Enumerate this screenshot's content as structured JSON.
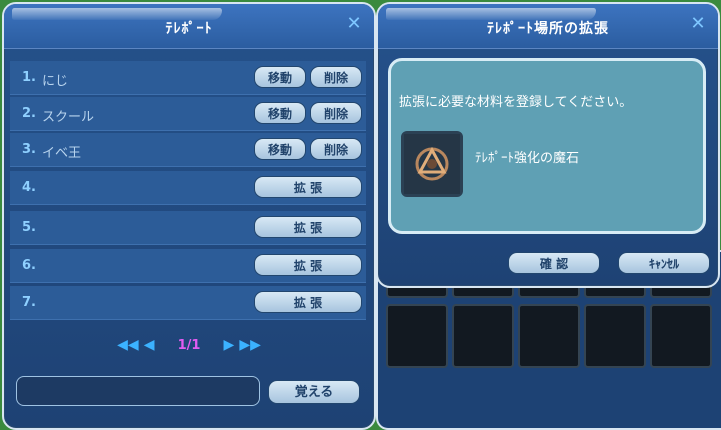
{
  "teleport_window": {
    "title": "ﾃﾚﾎﾟｰﾄ",
    "slots": [
      {
        "num": "1.",
        "name": "にじ",
        "move_label": "移動",
        "delete_label": "削除"
      },
      {
        "num": "2.",
        "name": "スクール",
        "move_label": "移動",
        "delete_label": "削除"
      },
      {
        "num": "3.",
        "name": "イベ王",
        "move_label": "移動",
        "delete_label": "削除"
      },
      {
        "num": "4.",
        "name": "",
        "expand_label": "拡 張"
      },
      {
        "num": "5.",
        "name": "",
        "expand_label": "拡 張"
      },
      {
        "num": "6.",
        "name": "",
        "expand_label": "拡 張"
      },
      {
        "num": "7.",
        "name": "",
        "expand_label": "拡 張"
      }
    ],
    "pager": {
      "page": "1/1",
      "first": "◀◀",
      "prev": "◀",
      "next": "▶",
      "last": "▶▶"
    },
    "memorize_label": "覚える",
    "close": "✕"
  },
  "expand_window": {
    "title": "ﾃﾚﾎﾟｰﾄ場所の拡張",
    "message": "拡張に必要な材料を登録してください。",
    "item_name": "ﾃﾚﾎﾟｰﾄ強化の魔石",
    "confirm_label": "確 認",
    "cancel_label": "ｷｬﾝｾﾙ",
    "close": "✕"
  },
  "colors": {
    "window_bg": "#245089",
    "slot_bg": "#2c5c98",
    "button_bg": "#c9dded",
    "inner_box_bg": "#5fa0b4",
    "page_number": "#e25cf1",
    "slot_number": "#8fd0ff"
  }
}
